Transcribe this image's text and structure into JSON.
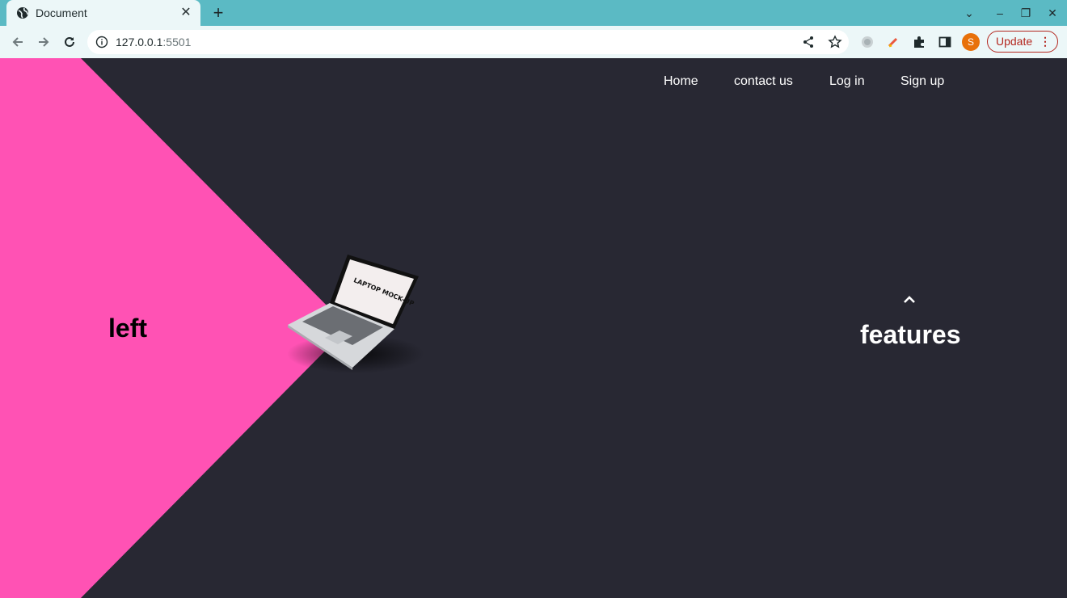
{
  "browser": {
    "tab_title": "Document",
    "tab_close": "✕",
    "new_tab": "+",
    "url_host": "127.0.0.1",
    "url_port": ":5501",
    "profile_initial": "S",
    "update_label": "Update",
    "update_menu": "⋮",
    "window_controls": {
      "dropdown": "⌄",
      "minimize": "–",
      "restore": "❐",
      "close": "✕"
    }
  },
  "nav": {
    "items": [
      "Home",
      "contact us",
      "Log in",
      "Sign up"
    ]
  },
  "hero": {
    "left_label": "left",
    "features_label": "features",
    "laptop_screen_text": "LAPTOP MOCK-UP"
  },
  "colors": {
    "tab_strip": "#5bbac4",
    "page_background": "#282833",
    "wedge": "#ff52b4",
    "update_accent": "#b3261e"
  }
}
